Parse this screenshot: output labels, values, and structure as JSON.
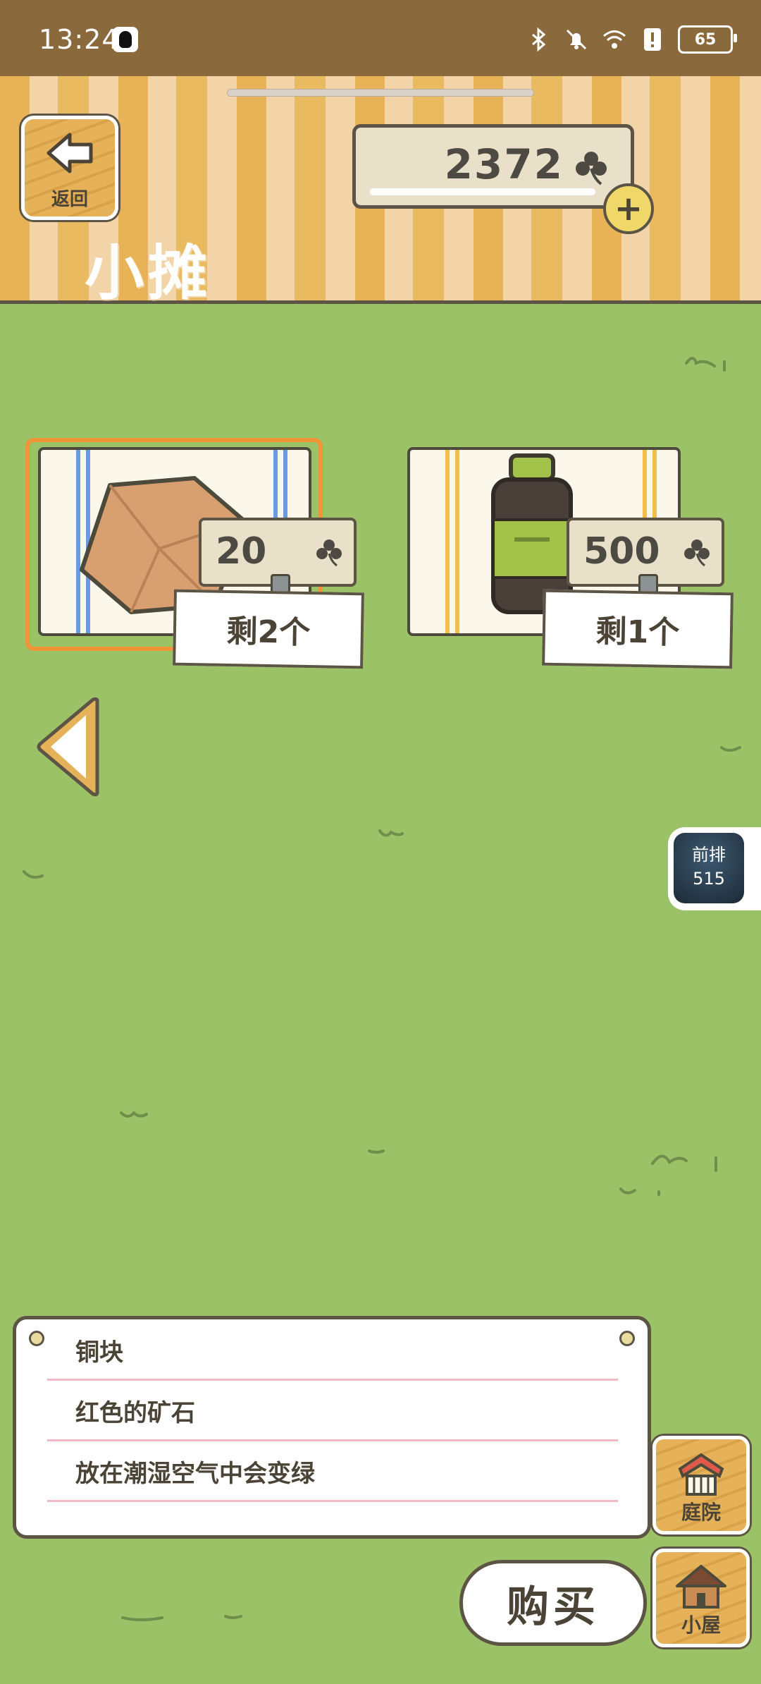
{
  "status_bar": {
    "time": "13:24",
    "battery": "65"
  },
  "header": {
    "back_label": "返回",
    "coin_count": "2372",
    "title": "小摊"
  },
  "items": [
    {
      "name": "copper-block",
      "price": "20",
      "stock": "剩2个",
      "selected": true
    },
    {
      "name": "bottle",
      "price": "500",
      "stock": "剩1个",
      "selected": false
    }
  ],
  "rank": {
    "label": "前排",
    "number": "515"
  },
  "description": {
    "name": "铜块",
    "line1": "红色的矿石",
    "line2": "放在潮湿空气中会变绿"
  },
  "buttons": {
    "buy": "购买",
    "yard": "庭院",
    "house": "小屋"
  },
  "colors": {
    "grass": "#9cc268",
    "selection": "#f0943a",
    "panel_border": "#5c5444"
  }
}
